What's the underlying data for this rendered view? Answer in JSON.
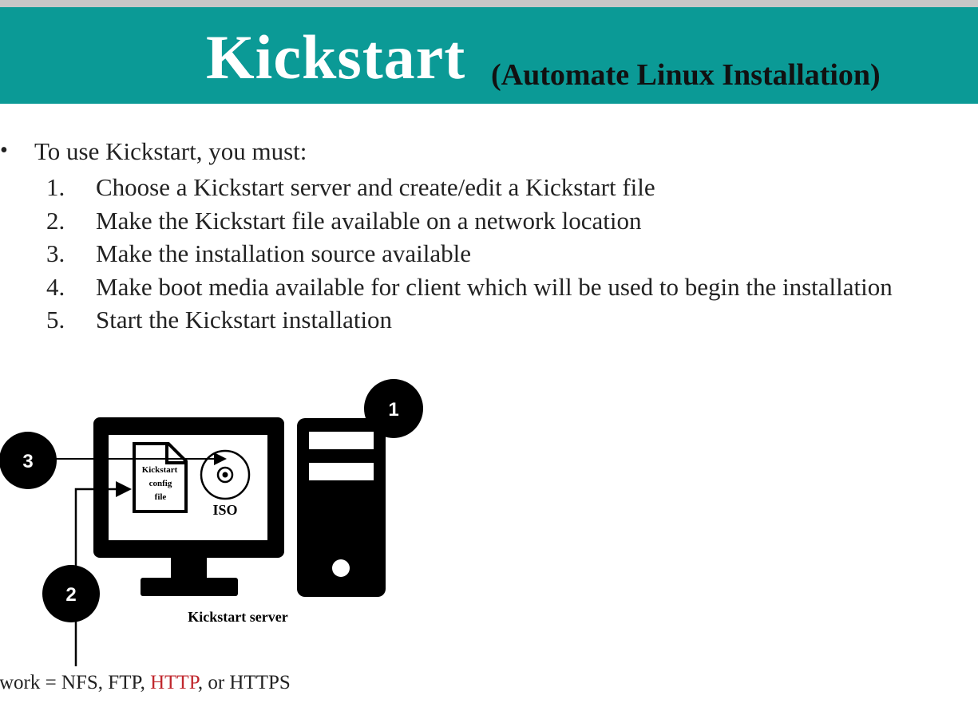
{
  "header": {
    "title": "Kickstart",
    "subtitle": "(Automate Linux Installation)"
  },
  "content": {
    "intro": "To use Kickstart, you must:",
    "steps": [
      {
        "num": "1.",
        "text": "Choose a Kickstart server and create/edit a Kickstart file"
      },
      {
        "num": "2.",
        "text": "Make the Kickstart file available on a network location"
      },
      {
        "num": "3.",
        "text": "Make the installation source available"
      },
      {
        "num": "4.",
        "text": "Make boot media available for client which will be used to begin the installation"
      },
      {
        "num": "5.",
        "text": "Start the Kickstart installation"
      }
    ]
  },
  "diagram": {
    "markers": [
      "1",
      "2",
      "3"
    ],
    "file_label_line1": "Kickstart",
    "file_label_line2": "config",
    "file_label_line3": "file",
    "iso_label": "ISO",
    "server_label": "Kickstart server",
    "network_prefix": "twork = NFS, FTP, ",
    "network_http": "HTTP",
    "network_suffix": ", or HTTPS"
  },
  "colors": {
    "header_bg": "#0b9a96",
    "http_highlight": "#c0272d"
  }
}
